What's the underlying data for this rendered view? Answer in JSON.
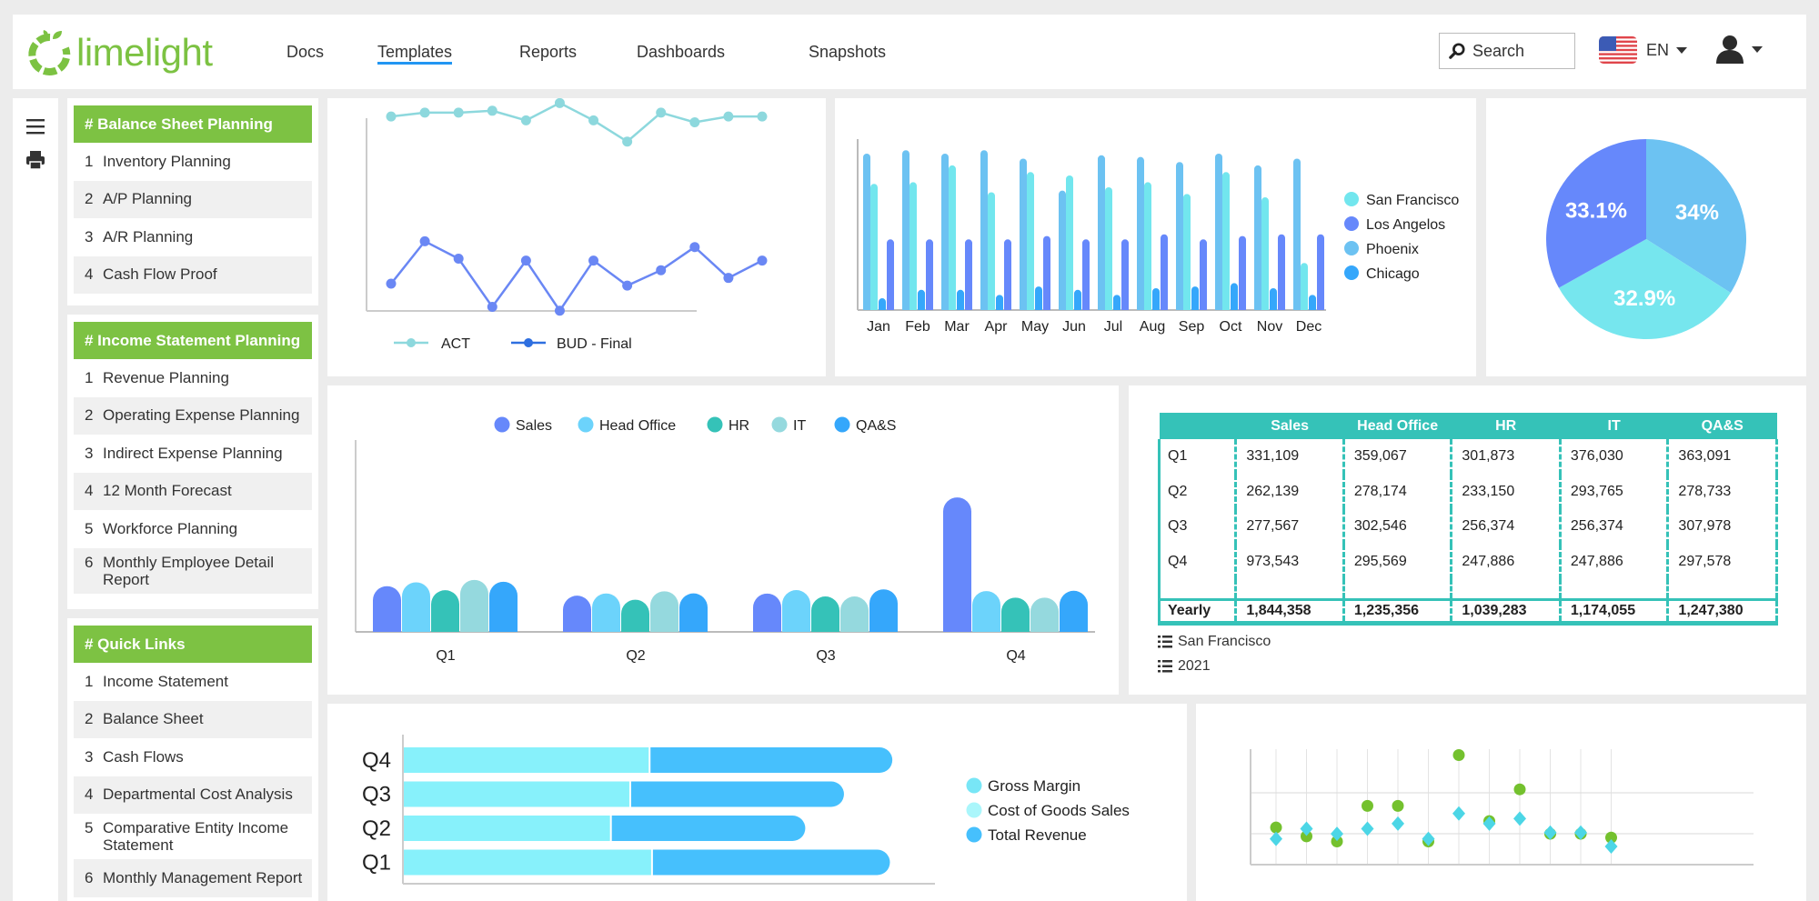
{
  "header": {
    "logo_text": "limelight",
    "nav": [
      {
        "label": "Docs",
        "active": false
      },
      {
        "label": "Templates",
        "active": true
      },
      {
        "label": "Reports",
        "active": false
      },
      {
        "label": "Dashboards",
        "active": false
      },
      {
        "label": "Snapshots",
        "active": false
      }
    ],
    "search_placeholder": "Search",
    "language": "EN",
    "icons": {
      "search": "search-icon",
      "flag": "us-flag-icon",
      "user": "user-icon",
      "menu": "hamburger-icon",
      "print": "print-icon"
    }
  },
  "sidebar": {
    "sections": [
      {
        "title": "# Balance Sheet Planning",
        "items": [
          {
            "num": "1",
            "label": "Inventory Planning"
          },
          {
            "num": "2",
            "label": "A/P Planning"
          },
          {
            "num": "3",
            "label": "A/R Planning"
          },
          {
            "num": "4",
            "label": "Cash Flow Proof"
          }
        ]
      },
      {
        "title": "# Income Statement Planning",
        "items": [
          {
            "num": "1",
            "label": "Revenue Planning"
          },
          {
            "num": "2",
            "label": "Operating Expense Planning"
          },
          {
            "num": "3",
            "label": "Indirect Expense Planning"
          },
          {
            "num": "4",
            "label": "12 Month Forecast"
          },
          {
            "num": "5",
            "label": "Workforce Planning"
          },
          {
            "num": "6",
            "label": "Monthly Employee Detail Report"
          }
        ]
      },
      {
        "title": "# Quick Links",
        "items": [
          {
            "num": "1",
            "label": "Income Statement"
          },
          {
            "num": "2",
            "label": "Balance Sheet"
          },
          {
            "num": "3",
            "label": "Cash Flows"
          },
          {
            "num": "4",
            "label": "Departmental Cost Analysis"
          },
          {
            "num": "5",
            "label": "Comparative Entity Income Statement"
          },
          {
            "num": "6",
            "label": "Monthly Management Report"
          }
        ]
      }
    ]
  },
  "table": {
    "columns": [
      "",
      "Sales",
      "Head Office",
      "HR",
      "IT",
      "QA&S"
    ],
    "rows": [
      [
        "Q1",
        "331,109",
        "359,067",
        "301,873",
        "376,030",
        "363,091"
      ],
      [
        "Q2",
        "262,139",
        "278,174",
        "233,150",
        "293,765",
        "278,733"
      ],
      [
        "Q3",
        "277,567",
        "302,546",
        "256,374",
        "256,374",
        "307,978"
      ],
      [
        "Q4",
        "973,543",
        "295,569",
        "247,886",
        "247,886",
        "297,578"
      ]
    ],
    "total_row": [
      "Yearly",
      "1,844,358",
      "1,235,356",
      "1,039,283",
      "1,174,055",
      "1,247,380"
    ],
    "filters": [
      "San Francisco",
      "2021"
    ],
    "accent": "#35c2b8"
  },
  "chart_data": [
    {
      "type": "line",
      "title": "",
      "x": [
        "1",
        "2",
        "3",
        "4",
        "5",
        "6",
        "7",
        "8",
        "9",
        "10",
        "11",
        "12",
        "13"
      ],
      "series": [
        {
          "name": "ACT",
          "color": "#8dd8dd",
          "values": [
            82,
            84,
            84,
            85,
            80,
            89,
            80,
            69,
            84,
            79,
            82,
            82
          ]
        },
        {
          "name": "BUD - Final",
          "color": "#6a87f4",
          "values": [
            33,
            55,
            46,
            21,
            45,
            19,
            45,
            32,
            40,
            52,
            36,
            45
          ]
        }
      ],
      "ylim": [
        0,
        100
      ],
      "legend": "bottom"
    },
    {
      "type": "bar",
      "categories": [
        "Jan",
        "Feb",
        "Mar",
        "Apr",
        "May",
        "Jun",
        "Jul",
        "Aug",
        "Sep",
        "Oct",
        "Nov",
        "Dec"
      ],
      "series": [
        {
          "name": "Phoenix",
          "color": "#6cc2f2",
          "values": [
            93,
            95,
            93,
            95,
            90,
            71,
            92,
            91,
            88,
            93,
            86,
            90
          ]
        },
        {
          "name": "San Francisco",
          "color": "#72e6ee",
          "values": [
            75,
            76,
            86,
            70,
            82,
            80,
            73,
            76,
            69,
            82,
            67,
            28
          ]
        },
        {
          "name": "Chicago",
          "color": "#35a7fb",
          "values": [
            7,
            12,
            12,
            9,
            14,
            12,
            9,
            13,
            14,
            16,
            13,
            9
          ]
        },
        {
          "name": "Los Angeles",
          "color": "#6688fb",
          "values": [
            42,
            42,
            42,
            42,
            44,
            42,
            42,
            45,
            42,
            44,
            45,
            45
          ]
        }
      ],
      "legend_order": [
        "San Francisco",
        "Los Angelos",
        "Phoenix",
        "Chicago"
      ],
      "legend_colors": [
        "#72e6ee",
        "#6688fb",
        "#6cc2f2",
        "#35a7fb"
      ],
      "ylim": [
        0,
        100
      ],
      "legend": "right"
    },
    {
      "type": "pie",
      "slices": [
        {
          "label": "34%",
          "value": 34.0,
          "color": "#6cc2f2"
        },
        {
          "label": "32.9%",
          "value": 32.9,
          "color": "#76e6ee"
        },
        {
          "label": "33.1%",
          "value": 33.1,
          "color": "#6688fb"
        }
      ]
    },
    {
      "type": "bar",
      "categories": [
        "Q1",
        "Q2",
        "Q3",
        "Q4"
      ],
      "series": [
        {
          "name": "Sales",
          "color": "#6688fb",
          "values": [
            331109,
            262139,
            277567,
            973543
          ]
        },
        {
          "name": "Head Office",
          "color": "#6cd3fb",
          "values": [
            359067,
            278174,
            302546,
            295569
          ]
        },
        {
          "name": "HR",
          "color": "#35c2b8",
          "values": [
            301873,
            233150,
            256374,
            247886
          ]
        },
        {
          "name": "IT",
          "color": "#95d9de",
          "values": [
            376030,
            293765,
            256374,
            247886
          ]
        },
        {
          "name": "QA&S",
          "color": "#35a7fb",
          "values": [
            363091,
            278733,
            307978,
            297578
          ]
        }
      ],
      "ylim": [
        0,
        1000000
      ],
      "legend": "top"
    },
    {
      "type": "bar",
      "orientation": "horizontal",
      "stacked": true,
      "categories": [
        "Q4",
        "Q3",
        "Q2",
        "Q1"
      ],
      "series": [
        {
          "name": "Cost of Goods Sales",
          "color": "#87f1fb",
          "values": [
            51,
            47,
            43,
            51.5
          ]
        },
        {
          "name": "Total Revenue",
          "color": "#46c0fd",
          "values": [
            50,
            44,
            40,
            49
          ]
        }
      ],
      "legend_entries": [
        {
          "name": "Gross Margin",
          "color": "#78e6f6"
        },
        {
          "name": "Cost of Goods Sales",
          "color": "#aaf6fb"
        },
        {
          "name": "Total Revenue",
          "color": "#46c0fd"
        }
      ],
      "xlim": [
        0,
        110
      ],
      "legend": "right"
    },
    {
      "type": "scatter",
      "x": [
        1,
        2,
        3,
        4,
        5,
        6,
        7,
        8,
        9,
        10,
        11,
        12
      ],
      "series": [
        {
          "name": "series-circle",
          "marker": "circle",
          "color": "#74c12e",
          "values": [
            35,
            28,
            24,
            52,
            52,
            24,
            92,
            40,
            65,
            30,
            30,
            27
          ]
        },
        {
          "name": "series-diamond",
          "marker": "diamond",
          "color": "#4cd6e6",
          "values": [
            26,
            34,
            30,
            34,
            38,
            26,
            46,
            38,
            42,
            31,
            31,
            20
          ]
        }
      ],
      "ylim": [
        0,
        100
      ],
      "grid": true
    }
  ]
}
